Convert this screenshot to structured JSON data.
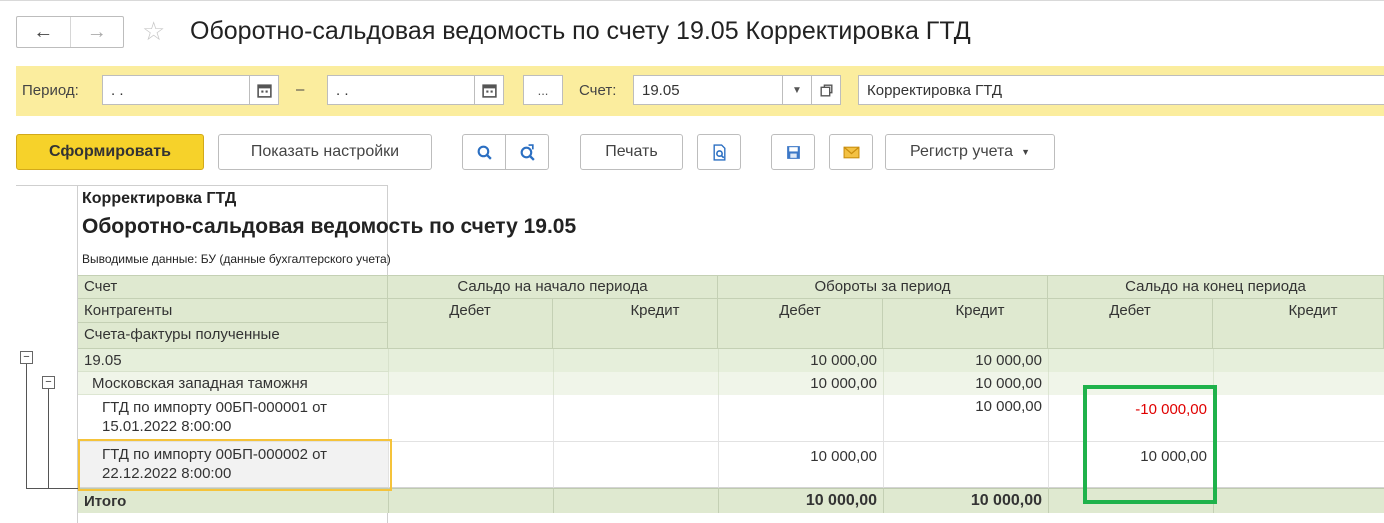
{
  "nav": {
    "back": "←",
    "forward": "→"
  },
  "title": "Оборотно-сальдовая ведомость по счету 19.05 Корректировка ГТД",
  "params": {
    "period_label": "Период:",
    "period_from": ". .",
    "dash": "–",
    "period_to": ". .",
    "more": "...",
    "account_label": "Счет:",
    "account_value": "19.05",
    "account_name": "Корректировка ГТД"
  },
  "toolbar": {
    "generate": "Сформировать",
    "settings": "Показать настройки",
    "print": "Печать",
    "register": "Регистр учета"
  },
  "report": {
    "caption": "Корректировка ГТД",
    "heading": "Оборотно-сальдовая ведомость по счету 19.05",
    "output_data": "Выводимые данные: БУ (данные бухгалтерского учета)",
    "headers": {
      "col1_line1": "Счет",
      "col1_line2": "Контрагенты",
      "col1_line3": "Счета-фактуры полученные",
      "start_balance": "Сальдо на начало периода",
      "turnover": "Обороты за период",
      "end_balance": "Сальдо на конец периода",
      "debit": "Дебет",
      "credit": "Кредит"
    },
    "rows": [
      {
        "name": "19.05",
        "name2": "",
        "start_dt": "",
        "start_kt": "",
        "turn_dt": "10 000,00",
        "turn_kt": "10 000,00",
        "end_dt": "",
        "end_kt": ""
      },
      {
        "name": "Московская западная таможня",
        "name2": "",
        "start_dt": "",
        "start_kt": "",
        "turn_dt": "10 000,00",
        "turn_kt": "10 000,00",
        "end_dt": "",
        "end_kt": ""
      },
      {
        "name": "ГТД по импорту 00БП-000001 от",
        "name2": "15.01.2022 8:00:00",
        "start_dt": "",
        "start_kt": "",
        "turn_dt": "",
        "turn_kt": "10 000,00",
        "end_dt": "-10 000,00",
        "end_kt": ""
      },
      {
        "name": "ГТД по импорту 00БП-000002 от",
        "name2": "22.12.2022 8:00:00",
        "start_dt": "",
        "start_kt": "",
        "turn_dt": "10 000,00",
        "turn_kt": "",
        "end_dt": "10 000,00",
        "end_kt": ""
      }
    ],
    "total": {
      "name": "Итого",
      "turn_dt": "10 000,00",
      "turn_kt": "10 000,00"
    },
    "colors": {
      "negative": "#e00000",
      "highlight_green": "#1fb24b",
      "highlight_yellow": "#f5c33a",
      "header_bg": "#dfe9d0"
    }
  }
}
